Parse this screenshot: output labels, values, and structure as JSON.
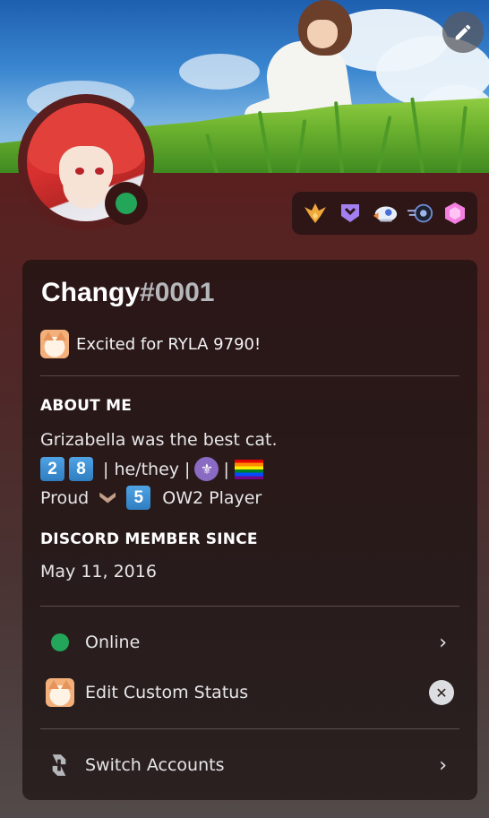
{
  "profile": {
    "username": "Changy",
    "discriminator": "#0001",
    "status": "online",
    "custom_status": {
      "emoji": "cat-emoji",
      "text": "Excited for RYLA 9790!"
    }
  },
  "badges": [
    {
      "name": "hypesquad-brilliance-badge-icon"
    },
    {
      "name": "nitro-badge-icon"
    },
    {
      "name": "wumpus-ship-badge-icon"
    },
    {
      "name": "speed-boost-badge-icon"
    },
    {
      "name": "server-boost-gem-badge-icon"
    }
  ],
  "about_me": {
    "title": "ABOUT ME",
    "line1": "Grizabella was the best cat.",
    "line2": {
      "keycap1": "2",
      "keycap2": "8",
      "pronouns": "| he/they |",
      "sep": "|"
    },
    "line3": {
      "prefix": "Proud",
      "keycap": "5",
      "suffix": "OW2 Player"
    }
  },
  "member_since": {
    "title": "DISCORD MEMBER SINCE",
    "date": "May 11, 2016"
  },
  "menu": {
    "online_label": "Online",
    "edit_status_label": "Edit Custom Status",
    "switch_accounts_label": "Switch Accounts"
  },
  "colors": {
    "online": "#23a55a",
    "keycap": "#2f7ec2",
    "card_bg": "#1c1212"
  }
}
